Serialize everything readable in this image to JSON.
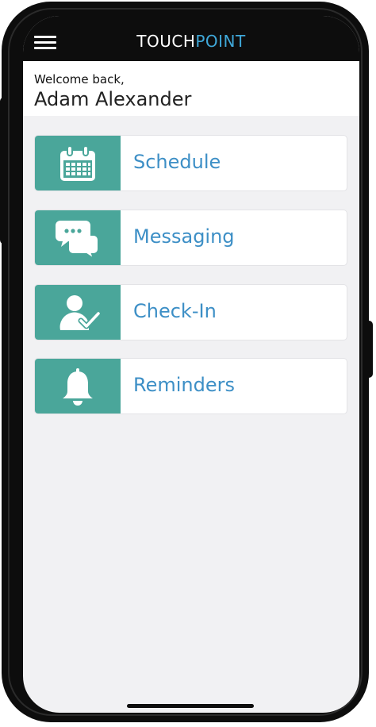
{
  "header": {
    "title_part1": "TOUCH",
    "title_part2": "POINT",
    "menu_icon": "hamburger-menu-icon"
  },
  "welcome": {
    "greeting": "Welcome back,",
    "user_name": "Adam Alexander"
  },
  "menu": [
    {
      "label": "Schedule",
      "icon": "calendar-icon"
    },
    {
      "label": "Messaging",
      "icon": "chat-bubbles-icon"
    },
    {
      "label": "Check-In",
      "icon": "user-check-icon"
    },
    {
      "label": "Reminders",
      "icon": "bell-icon"
    }
  ],
  "colors": {
    "accent_teal": "#4aa69a",
    "label_blue": "#3d8fc6",
    "title_blue": "#3fa8d9",
    "device_black": "#0d0d0d",
    "screen_bg": "#f1f1f3"
  }
}
